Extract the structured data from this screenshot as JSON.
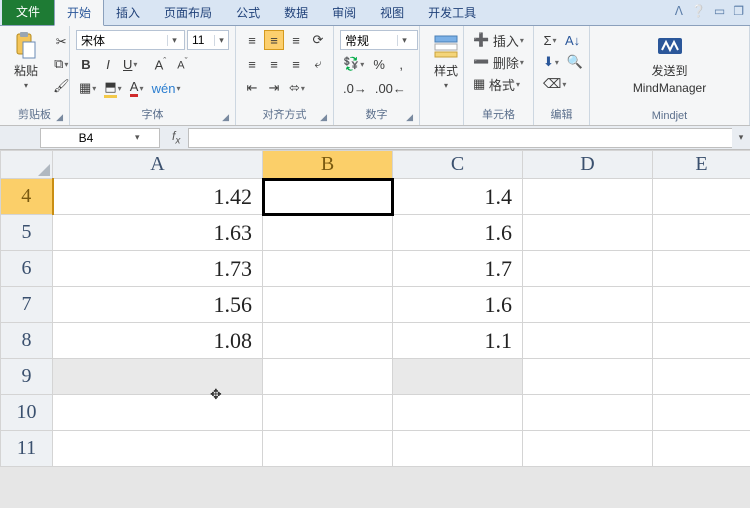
{
  "tabs": {
    "file": "文件",
    "home": "开始",
    "insert": "插入",
    "layout": "页面布局",
    "formulas": "公式",
    "data": "数据",
    "review": "审阅",
    "view": "视图",
    "dev": "开发工具"
  },
  "ribbon": {
    "clipboard": {
      "paste": "粘贴",
      "label": "剪贴板"
    },
    "font": {
      "name": "宋体",
      "size": "11",
      "label": "字体"
    },
    "align": {
      "label": "对齐方式"
    },
    "number": {
      "format": "常规",
      "label": "数字"
    },
    "styles": {
      "btn": "样式",
      "label": ""
    },
    "cells": {
      "insert": "插入",
      "delete": "删除",
      "format": "格式",
      "label": "单元格"
    },
    "editing": {
      "label": "编辑"
    },
    "mindjet": {
      "send": "发送到",
      "app": "MindManager",
      "label": "Mindjet"
    }
  },
  "formula_bar": {
    "cell_ref": "B4",
    "value": ""
  },
  "sheet": {
    "columns": [
      "A",
      "B",
      "C",
      "D",
      "E"
    ],
    "row_start": 4,
    "rows": [
      {
        "n": 4,
        "A": "1.42",
        "B": "",
        "C": "1.4",
        "D": "",
        "E": ""
      },
      {
        "n": 5,
        "A": "1.63",
        "B": "",
        "C": "1.6",
        "D": "",
        "E": ""
      },
      {
        "n": 6,
        "A": "1.73",
        "B": "",
        "C": "1.7",
        "D": "",
        "E": ""
      },
      {
        "n": 7,
        "A": "1.56",
        "B": "",
        "C": "1.6",
        "D": "",
        "E": ""
      },
      {
        "n": 8,
        "A": "1.08",
        "B": "",
        "C": "1.1",
        "D": "",
        "E": ""
      },
      {
        "n": 9,
        "A": "",
        "B": "",
        "C": "",
        "D": "",
        "E": ""
      },
      {
        "n": 10,
        "A": "",
        "B": "",
        "C": "",
        "D": "",
        "E": ""
      },
      {
        "n": 11,
        "A": "",
        "B": "",
        "C": "",
        "D": "",
        "E": ""
      }
    ],
    "active_cell": "B4",
    "selected_col": "B",
    "selected_row": 4,
    "gray_row": 9,
    "gray_cols": [
      "A",
      "C"
    ]
  }
}
